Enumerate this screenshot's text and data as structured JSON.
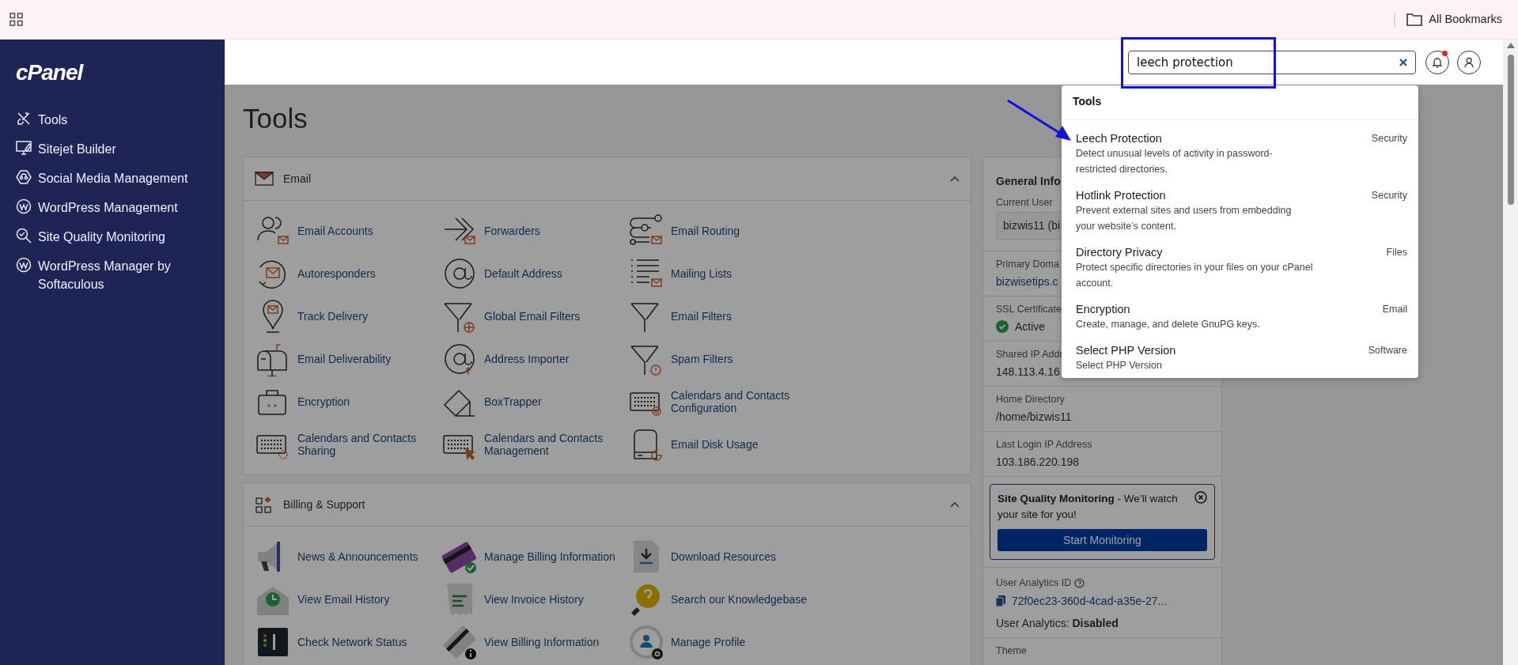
{
  "browser_bar": {
    "bookmarks_label": "All Bookmarks"
  },
  "sidebar": {
    "logo": "cPanel",
    "items": [
      {
        "label": "Tools"
      },
      {
        "label": "Sitejet Builder"
      },
      {
        "label": "Social Media Management"
      },
      {
        "label": "WordPress Management"
      },
      {
        "label": "Site Quality Monitoring"
      },
      {
        "label": "WordPress Manager by Softaculous"
      }
    ]
  },
  "header": {
    "search": {
      "value": "leech protection"
    },
    "notification_unread": true
  },
  "page_title": "Tools",
  "sections": [
    {
      "title": "Email",
      "expanded": true,
      "items": [
        {
          "label": "Email Accounts"
        },
        {
          "label": "Forwarders"
        },
        {
          "label": "Email Routing"
        },
        {
          "label": "Autoresponders"
        },
        {
          "label": "Default Address"
        },
        {
          "label": "Mailing Lists"
        },
        {
          "label": "Track Delivery"
        },
        {
          "label": "Global Email Filters"
        },
        {
          "label": "Email Filters"
        },
        {
          "label": "Email Deliverability"
        },
        {
          "label": "Address Importer"
        },
        {
          "label": "Spam Filters"
        },
        {
          "label": "Encryption"
        },
        {
          "label": "BoxTrapper"
        },
        {
          "label": "Calendars and Contacts Configuration"
        },
        {
          "label": "Calendars and Contacts Sharing"
        },
        {
          "label": "Calendars and Contacts Management"
        },
        {
          "label": "Email Disk Usage"
        }
      ]
    },
    {
      "title": "Billing & Support",
      "expanded": true,
      "items": [
        {
          "label": "News & Announcements"
        },
        {
          "label": "Manage Billing Information"
        },
        {
          "label": "Download Resources"
        },
        {
          "label": "View Email History"
        },
        {
          "label": "View Invoice History"
        },
        {
          "label": "Search our Knowledgebase"
        },
        {
          "label": "Check Network Status"
        },
        {
          "label": "View Billing Information"
        },
        {
          "label": "Manage Profile"
        }
      ]
    }
  ],
  "general_info": {
    "title": "General Info",
    "fields": [
      {
        "label": "Current User",
        "value": "bizwis11 (bi",
        "kind": "box"
      },
      {
        "label": "Primary Doma",
        "value": "bizwisetips.c",
        "kind": "link"
      },
      {
        "label": "SSL Certificate",
        "value": "Active",
        "kind": "status"
      },
      {
        "label": "Shared IP Addr",
        "value": "148.113.4.16",
        "kind": "text"
      },
      {
        "label": "Home Directory",
        "value": "/home/bizwis11",
        "kind": "text"
      },
      {
        "label": "Last Login IP Address",
        "value": "103.186.220.198",
        "kind": "text"
      }
    ],
    "promo": {
      "text": "**Site Quality Monitoring** - We’ll watch your site for you!",
      "button": "Start Monitoring"
    },
    "analytics": {
      "label": "User Analytics ID",
      "id": "72f0ec23-360d-4cad-a35e-27...",
      "status": "User Analytics: **Disabled**"
    },
    "theme_label": "Theme"
  },
  "search_results": {
    "heading": "Tools",
    "items": [
      {
        "title": "Leech Protection",
        "description": "Detect unusual levels of activity in password-restricted directories.",
        "category": "Security"
      },
      {
        "title": "Hotlink Protection",
        "description": "Prevent external sites and users from embedding your website’s content.",
        "category": "Security"
      },
      {
        "title": "Directory Privacy",
        "description": "Protect specific directories in your files on your cPanel account.",
        "category": "Files"
      },
      {
        "title": "Encryption",
        "description": "Create, manage, and delete GnuPG keys.",
        "category": "Email"
      },
      {
        "title": "Select PHP Version",
        "description": "Select PHP Version",
        "category": "Software"
      }
    ]
  }
}
